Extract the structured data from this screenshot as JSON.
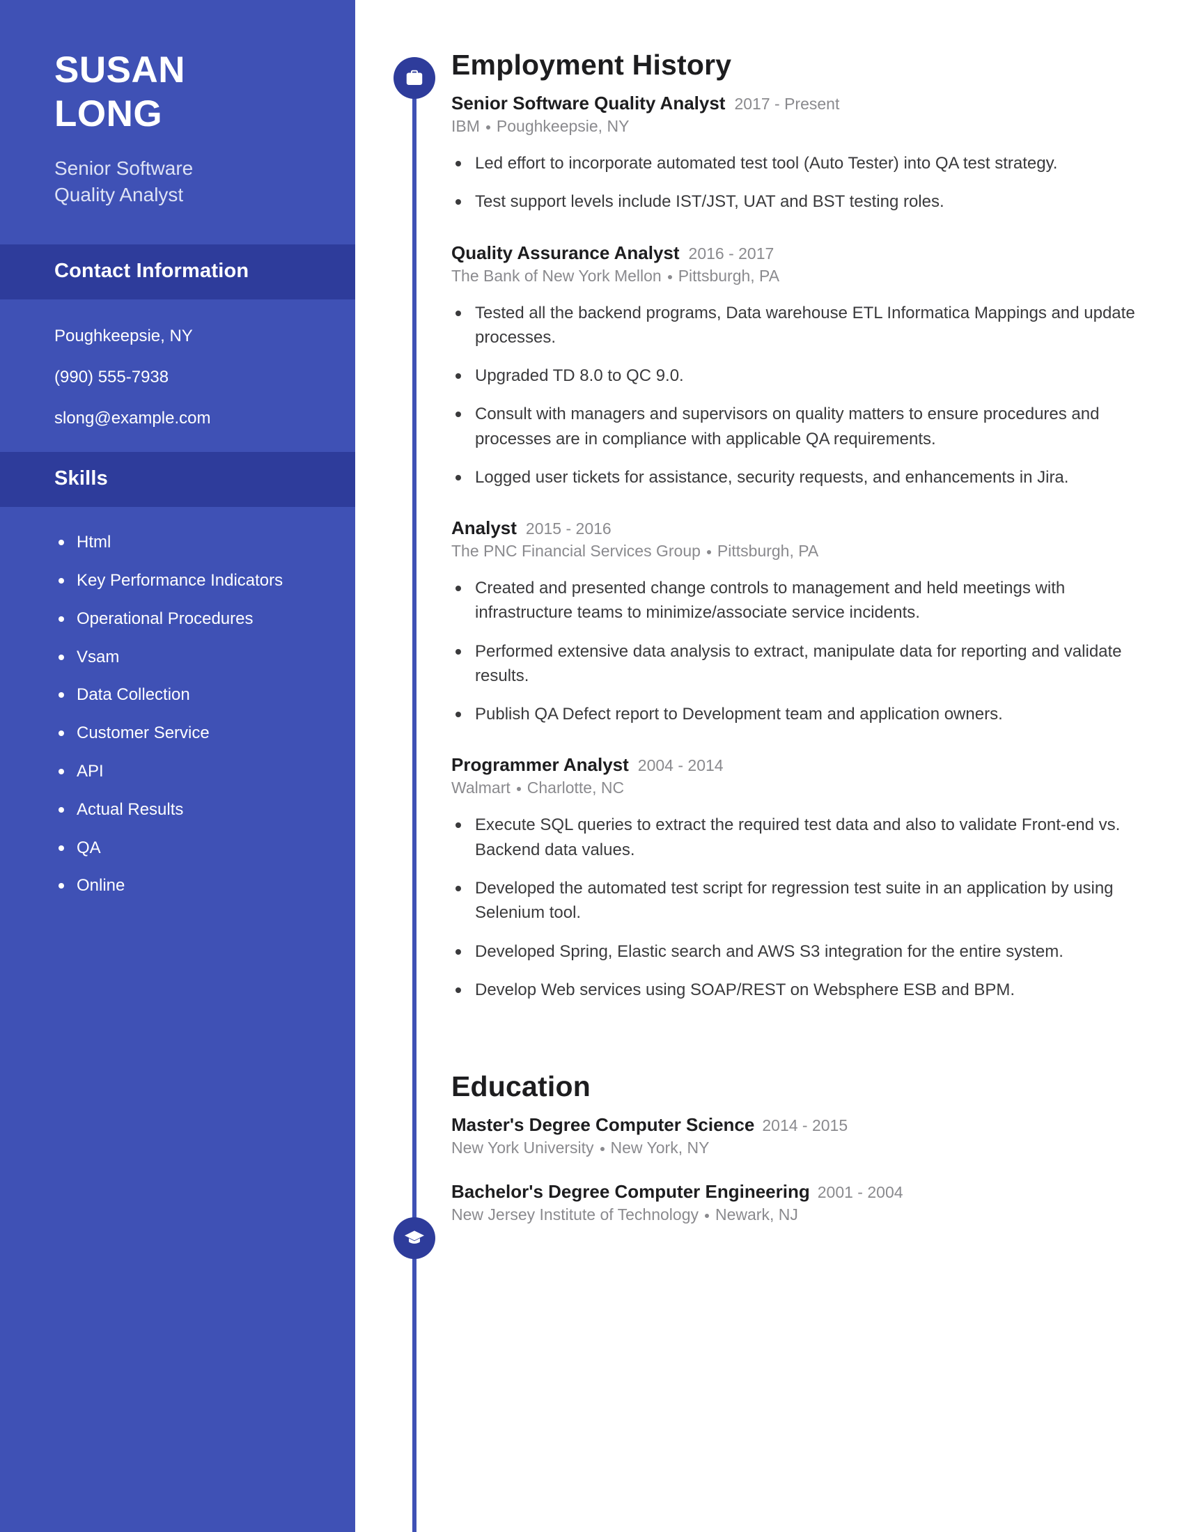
{
  "colors": {
    "sidebar_bg": "#3f51b5",
    "sidebar_header_bg": "#2e3c9b",
    "timeline": "#3f51b5",
    "icon_circle": "#2e3c9b",
    "heading_text": "#1d1d1f",
    "muted_text": "#8a8a8e",
    "body_text": "#3a3a3c"
  },
  "sidebar": {
    "name_first": "SUSAN",
    "name_last": "LONG",
    "headline_line1": "Senior Software",
    "headline_line2": "Quality Analyst",
    "contact": {
      "header": "Contact Information",
      "location": "Poughkeepsie, NY",
      "phone": "(990) 555-7938",
      "email": "slong@example.com"
    },
    "skills": {
      "header": "Skills",
      "items": [
        "Html",
        "Key Performance Indicators",
        "Operational Procedures",
        "Vsam",
        "Data Collection",
        "Customer Service",
        "API",
        "Actual Results",
        "QA",
        "Online"
      ]
    }
  },
  "employment": {
    "section_title": "Employment History",
    "icon": "briefcase-icon",
    "entries": [
      {
        "role": "Senior Software Quality Analyst",
        "dates": "2017 - Present",
        "company": "IBM",
        "location": "Poughkeepsie, NY",
        "bullets": [
          "Led effort to incorporate automated test tool (Auto Tester) into QA test strategy.",
          "Test support levels include IST/JST, UAT and BST testing roles."
        ]
      },
      {
        "role": "Quality Assurance Analyst",
        "dates": "2016 - 2017",
        "company": "The Bank of New York Mellon",
        "location": "Pittsburgh, PA",
        "bullets": [
          "Tested all the backend programs, Data warehouse ETL Informatica Mappings and update processes.",
          "Upgraded TD 8.0 to QC 9.0.",
          "Consult with managers and supervisors on quality matters to ensure procedures and processes are in compliance with applicable QA requirements.",
          "Logged user tickets for assistance, security requests, and enhancements in Jira."
        ]
      },
      {
        "role": "Analyst",
        "dates": "2015 - 2016",
        "company": "The PNC Financial Services Group",
        "location": "Pittsburgh, PA",
        "bullets": [
          "Created and presented change controls to management and held meetings with infrastructure teams to minimize/associate service incidents.",
          "Performed extensive data analysis to extract, manipulate data for reporting and validate results.",
          "Publish QA Defect report to Development team and application owners."
        ]
      },
      {
        "role": "Programmer Analyst",
        "dates": "2004 - 2014",
        "company": "Walmart",
        "location": "Charlotte, NC",
        "bullets": [
          "Execute SQL queries to extract the required test data and also to validate Front-end vs. Backend data values.",
          "Developed the automated test script for regression test suite in an application by using Selenium tool.",
          "Developed Spring, Elastic search and AWS S3 integration for the entire system.",
          "Develop Web services using SOAP/REST on Websphere ESB and BPM."
        ]
      }
    ]
  },
  "education": {
    "section_title": "Education",
    "icon": "graduation-cap-icon",
    "entries": [
      {
        "degree": "Master's Degree Computer Science",
        "dates": "2014 - 2015",
        "school": "New York University",
        "location": "New York, NY"
      },
      {
        "degree": "Bachelor's Degree Computer Engineering",
        "dates": "2001 - 2004",
        "school": "New Jersey Institute of Technology",
        "location": "Newark, NJ"
      }
    ]
  }
}
